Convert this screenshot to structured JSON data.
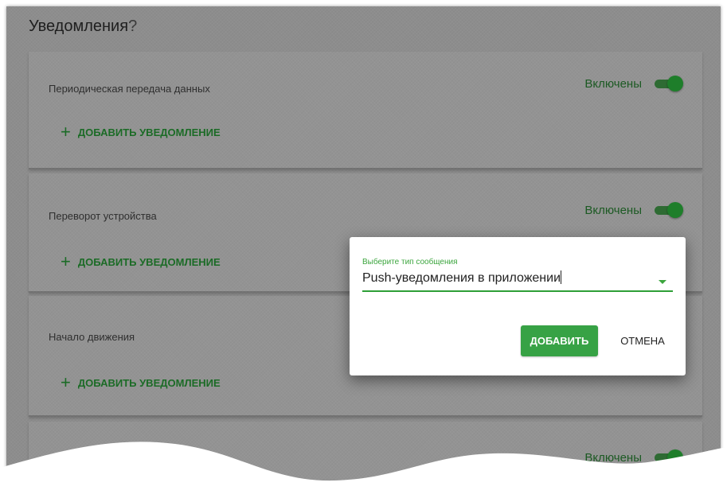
{
  "page": {
    "title": "Уведомления",
    "title_suffix": "?"
  },
  "cards": [
    {
      "title": "Периодическая передача данных",
      "toggle_label": "Включены",
      "add_label": "ДОБАВИТЬ УВЕДОМЛЕНИЕ"
    },
    {
      "title": "Переворот устройства",
      "toggle_label": "Включены",
      "add_label": "ДОБАВИТЬ УВЕДОМЛЕНИЕ"
    },
    {
      "title": "Начало движения",
      "add_label": "ДОБАВИТЬ УВЕДОМЛЕНИЕ"
    },
    {
      "toggle_label": "Включены"
    }
  ],
  "icons": {
    "add": "plus-icon",
    "select": "dropdown-arrow-icon"
  },
  "glyphs": {
    "plus": "+"
  },
  "dialog": {
    "field_label": "Выберите тип сообщения",
    "field_value": "Push-уведомления в приложении",
    "confirm_label": "ДОБАВИТЬ",
    "cancel_label": "ОТМЕНА"
  },
  "colors": {
    "accent": "#37a245",
    "toggle_on": "#1e7e2a",
    "overlay": "#8d8d8d"
  }
}
